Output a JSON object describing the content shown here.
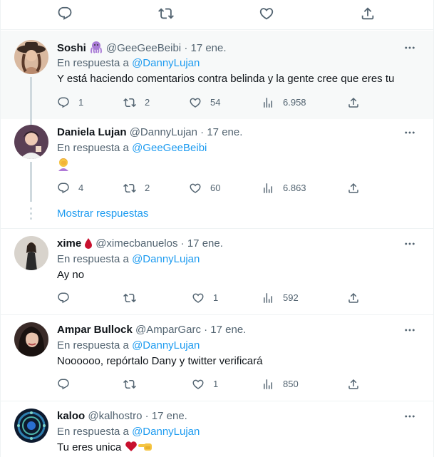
{
  "reply_prefix": "En respuesta a",
  "top_actions": [
    "reply-icon",
    "retweet-icon",
    "like-icon",
    "share-icon"
  ],
  "tweets": [
    {
      "name": "Soshi",
      "emoji_icon": "octopus-icon",
      "handle": "@GeeGeeBeibi",
      "dot": "·",
      "time": "17 ene.",
      "reply_to": "@DannyLujan",
      "text": "Y está haciendo comentarios contra belinda y la gente cree que eres tu",
      "replies": "1",
      "retweets": "2",
      "likes": "54",
      "views": "6.958"
    },
    {
      "name": "Daniela Lujan",
      "handle": "@DannyLujan",
      "dot": "·",
      "time": "17 ene.",
      "reply_to": "@GeeGeeBeibi",
      "text_icon": "woman-facepalming-icon",
      "replies": "4",
      "retweets": "2",
      "likes": "60",
      "views": "6.863"
    },
    {
      "name": "xime",
      "emoji_icon": "drop-of-blood-icon",
      "handle": "@ximecbanuelos",
      "dot": "·",
      "time": "17 ene.",
      "reply_to": "@DannyLujan",
      "text": "Ay no",
      "replies": "",
      "retweets": "",
      "likes": "1",
      "views": "592"
    },
    {
      "name": "Ampar Bullock",
      "handle": "@AmparGarc",
      "dot": "·",
      "time": "17 ene.",
      "reply_to": "@DannyLujan",
      "text": "Noooooo, repórtalo Dany y twitter verificará",
      "replies": "",
      "retweets": "",
      "likes": "1",
      "views": "850"
    },
    {
      "name": "kaloo",
      "handle": "@kalhostro",
      "dot": "·",
      "time": "17 ene.",
      "reply_to": "@DannyLujan",
      "text": "Tu eres unica",
      "text_icons": [
        "red-heart-icon",
        "pointing-left-hand-icon"
      ]
    }
  ],
  "show_replies": "Mostrar respuestas",
  "colors": {
    "accent": "#1d9bf0",
    "muted": "#536471",
    "highlight_bg": "#f7f9f9",
    "border": "#eff3f4"
  }
}
